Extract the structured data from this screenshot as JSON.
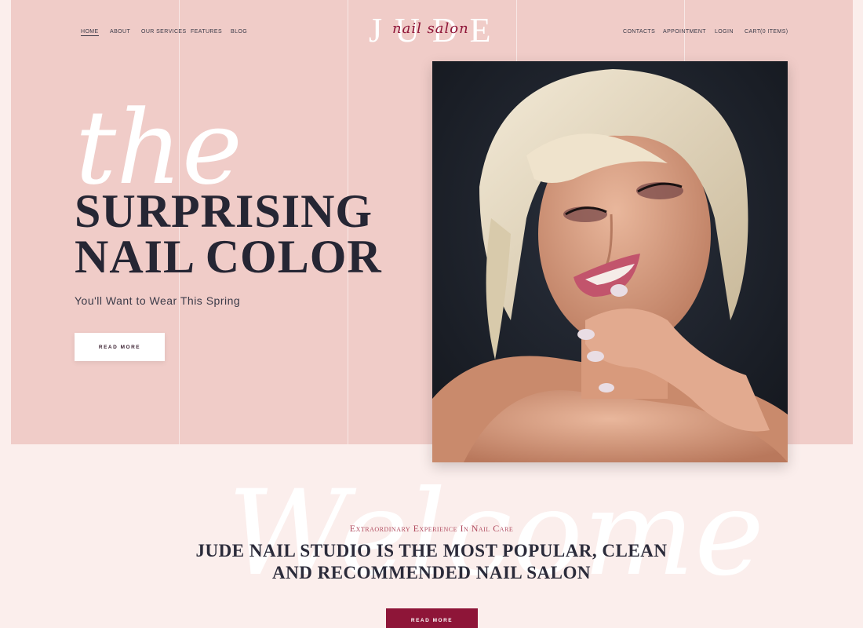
{
  "nav_left": [
    "HOME",
    "ABOUT",
    "OUR SERVICES",
    "FEATURES",
    "BLOG"
  ],
  "nav_right": [
    "CONTACTS",
    "APPOINTMENT",
    "LOGIN",
    "CART",
    "(0 ITEMS)"
  ],
  "logo": {
    "main": "JUDE",
    "script": "nail salon"
  },
  "hero": {
    "script_word": "the",
    "headline_line1": "SURPRISING",
    "headline_line2": "NAIL COLOR",
    "subhead": "You'll Want to Wear This Spring",
    "button_label": "READ MORE",
    "photo_icon": "woman-portrait-photo"
  },
  "welcome": {
    "script_word": "Welcome",
    "eyebrow": "Extraordinary Experience In Nail Care",
    "title_line1": "JUDE NAIL STUDIO IS THE MOST POPULAR, CLEAN",
    "title_line2": "AND RECOMMENDED NAIL SALON",
    "button_label": "READ MORE"
  },
  "colors": {
    "page_bg": "#fbeeec",
    "hero_bg": "#f0ccc8",
    "accent": "#8e1538",
    "text_dark": "#262634"
  }
}
